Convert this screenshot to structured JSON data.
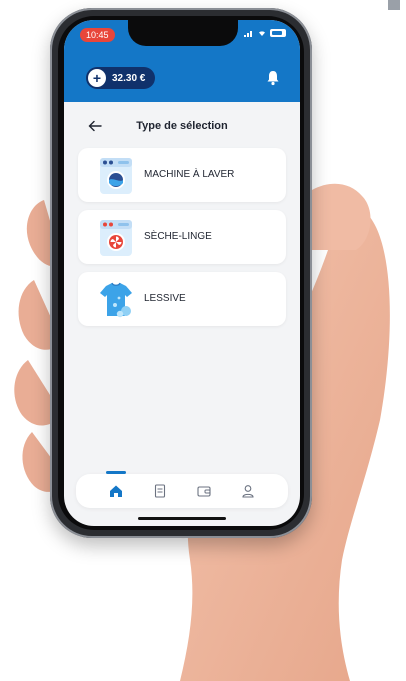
{
  "status": {
    "time": "10:45"
  },
  "header": {
    "balance": "32.30 €",
    "plus_symbol": "+"
  },
  "page": {
    "title": "Type de sélection"
  },
  "options": [
    {
      "label": "MACHINE À LAVER",
      "icon": "washing-machine-icon"
    },
    {
      "label": "SÈCHE-LINGE",
      "icon": "dryer-icon"
    },
    {
      "label": "LESSIVE",
      "icon": "detergent-shirt-icon"
    }
  ],
  "colors": {
    "header_blue": "#1477c7",
    "pill_navy": "#10316b",
    "background": "#f3f4f6",
    "status_red": "#e8463a"
  },
  "tabs": [
    {
      "icon": "home-icon",
      "active": true
    },
    {
      "icon": "receipt-icon",
      "active": false
    },
    {
      "icon": "wallet-icon",
      "active": false
    },
    {
      "icon": "user-icon",
      "active": false
    }
  ]
}
